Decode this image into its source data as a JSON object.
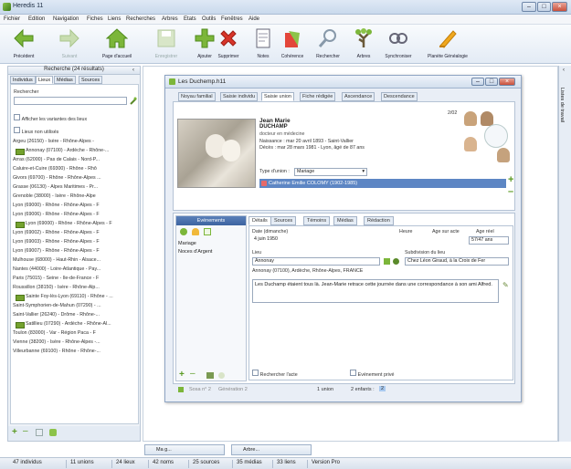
{
  "app": {
    "title": "Heredis 11"
  },
  "menu": [
    "Fichier",
    "Edition",
    "Navigation",
    "Fiches",
    "Liens",
    "Recherches",
    "Arbres",
    "Etats",
    "Outils",
    "Fenêtres",
    "Aide"
  ],
  "toolbar": [
    {
      "label": "Précédent",
      "icon": "arrow-left-icon",
      "disabled": false
    },
    {
      "label": "Suivant",
      "icon": "arrow-right-icon",
      "disabled": true
    },
    {
      "label": "Page d'accueil",
      "icon": "home-icon",
      "disabled": false
    },
    {
      "label": "Enregistrer",
      "icon": "save-icon",
      "disabled": true
    },
    {
      "label": "Ajouter",
      "icon": "plus-icon",
      "disabled": false
    },
    {
      "label": "Supprimer",
      "icon": "delete-icon",
      "disabled": false
    },
    {
      "label": "Notes",
      "icon": "notes-icon",
      "disabled": false
    },
    {
      "label": "Cohérence",
      "icon": "coherence-icon",
      "disabled": false
    },
    {
      "label": "Rechercher",
      "icon": "search-icon",
      "disabled": false
    },
    {
      "label": "Arbres",
      "icon": "tree-icon",
      "disabled": false
    },
    {
      "label": "Synchroniser",
      "icon": "sync-icon",
      "disabled": false
    },
    {
      "label": "Planète Généalogie",
      "icon": "planet-icon",
      "disabled": false
    }
  ],
  "left": {
    "header": "Recherche (24 résultats)",
    "tabs": [
      "Individus",
      "Lieux",
      "Médias",
      "Sources"
    ],
    "active_tab": 1,
    "search_label": "Rechercher",
    "search_value": "",
    "opt1": "Afficher les variantes des lieux",
    "opt2": "Lieux non utilisés",
    "places": [
      {
        "name": "Argeu (26150) - Isère - Rhône-Alpes -",
        "mark": false
      },
      {
        "name": "Annonay (07100) - Ardèche - Rhône-...",
        "mark": true
      },
      {
        "name": "Arras (62000) - Pas de Calais - Nord-P...",
        "mark": false
      },
      {
        "name": "Caluire-et-Cuire (69300) - Rhône - Rhô",
        "mark": false
      },
      {
        "name": "Givors (69700) - Rhône - Rhône-Alpes ...",
        "mark": false
      },
      {
        "name": "Grasse (06130) - Alpes Maritimes - Pr...",
        "mark": false
      },
      {
        "name": "Grenoble (38000) - Isère - Rhône-Alpe",
        "mark": false
      },
      {
        "name": "Lyon (69000) - Rhône - Rhône-Alpes - F",
        "mark": false
      },
      {
        "name": "Lyon (69006) - Rhône - Rhône-Alpes - F",
        "mark": false
      },
      {
        "name": "Lyon (69000) - Rhône - Rhône-Alpes - F",
        "mark": true
      },
      {
        "name": "Lyon (69002) - Rhône - Rhône-Alpes - F",
        "mark": false
      },
      {
        "name": "Lyon (69003) - Rhône - Rhône-Alpes - F",
        "mark": false
      },
      {
        "name": "Lyon (69007) - Rhône - Rhône-Alpes - F",
        "mark": false
      },
      {
        "name": "Mulhouse (68000) - Haut-Rhin - Alsace...",
        "mark": false
      },
      {
        "name": "Nantes (44000) - Loire-Atlantique - Pay...",
        "mark": false
      },
      {
        "name": "Paris (75015) - Seine - Île-de-France - F",
        "mark": false
      },
      {
        "name": "Roussillon (38150) - Isère - Rhône-Alp...",
        "mark": false
      },
      {
        "name": "Sainte Foy-lès-Lyon (69110) - Rhône - ...",
        "mark": true
      },
      {
        "name": "Saint-Symphorien-de-Mahun (07290) - ...",
        "mark": false
      },
      {
        "name": "Saint-Vallier (26240) - Drôme - Rhône-...",
        "mark": false
      },
      {
        "name": "Satillieu (07290) - Ardèche - Rhône-Al...",
        "mark": true
      },
      {
        "name": "Toulon (83000) - Var - Région Paca - F",
        "mark": false
      },
      {
        "name": "Vienne (38200) - Isère - Rhône-Alpes -...",
        "mark": false
      },
      {
        "name": "Villeurbanne (69100) - Rhône - Rhône-...",
        "mark": false
      }
    ]
  },
  "inner": {
    "title": "Les Duchemp.h11",
    "tabs": [
      "Noyau familial",
      "Saisie individu",
      "Saisie union",
      "Fiche rédigée",
      "Ascendance",
      "Descendance"
    ],
    "active_tab": 2,
    "page": "2/02",
    "person_first": "Jean Marie",
    "person_last": "DUCHAMP",
    "occupation": "docteur en médecine",
    "birth": "Naissance : mar 20 avril 1893 - Saint-Vallier",
    "death": "Décès : mar 28 mars 1981 - Lyon, âgé de 87 ans",
    "union_type_label": "Type d'union :",
    "union_type": "Mariage",
    "spouse": "Catherine Emilie COLOMY (1902-1985)",
    "events_header": "Evénements",
    "events": [
      "Mariage",
      "Noces d'Argent"
    ],
    "detail_tabs": [
      "Détails",
      "Sources",
      "Témoins",
      "Médias",
      "Rédaction"
    ],
    "date_label": "Date (dimanche)",
    "date_value": "4 juin 1950",
    "hour_label": "Heure",
    "age_act_label": "Age sur acte",
    "age_real_label": "Age réel",
    "age_real": "57/47 ans",
    "place_label": "Lieu",
    "place_value": "Annonay",
    "subdivision_label": "Subdivision du lieu",
    "subdivision_value": "Chez Léon Giraud, à la Croix de Fer",
    "place_full": "Annonay (07100), Ardèche, Rhône-Alpes, FRANCE",
    "note": "Les Duchamp étaient tous là. Jean-Marie retrace cette journée dans une correspondance à son ami Alfred.",
    "check1": "Rechercher l'acte",
    "check2": "Evénement privé",
    "footer_sosa": "Sosa n° 2",
    "footer_gen": "Génération 2",
    "footer_union": "1 union",
    "footer_children": "2 enfants :",
    "footer_children_count": "2"
  },
  "taskbar": [
    "Ma g...",
    "Arbre..."
  ],
  "right_strip": "Listes de travail",
  "status": [
    "47 individus",
    "11 unions",
    "24 lieux",
    "42 noms",
    "25 sources",
    "35 médias",
    "33 liens",
    "Version Pro"
  ]
}
